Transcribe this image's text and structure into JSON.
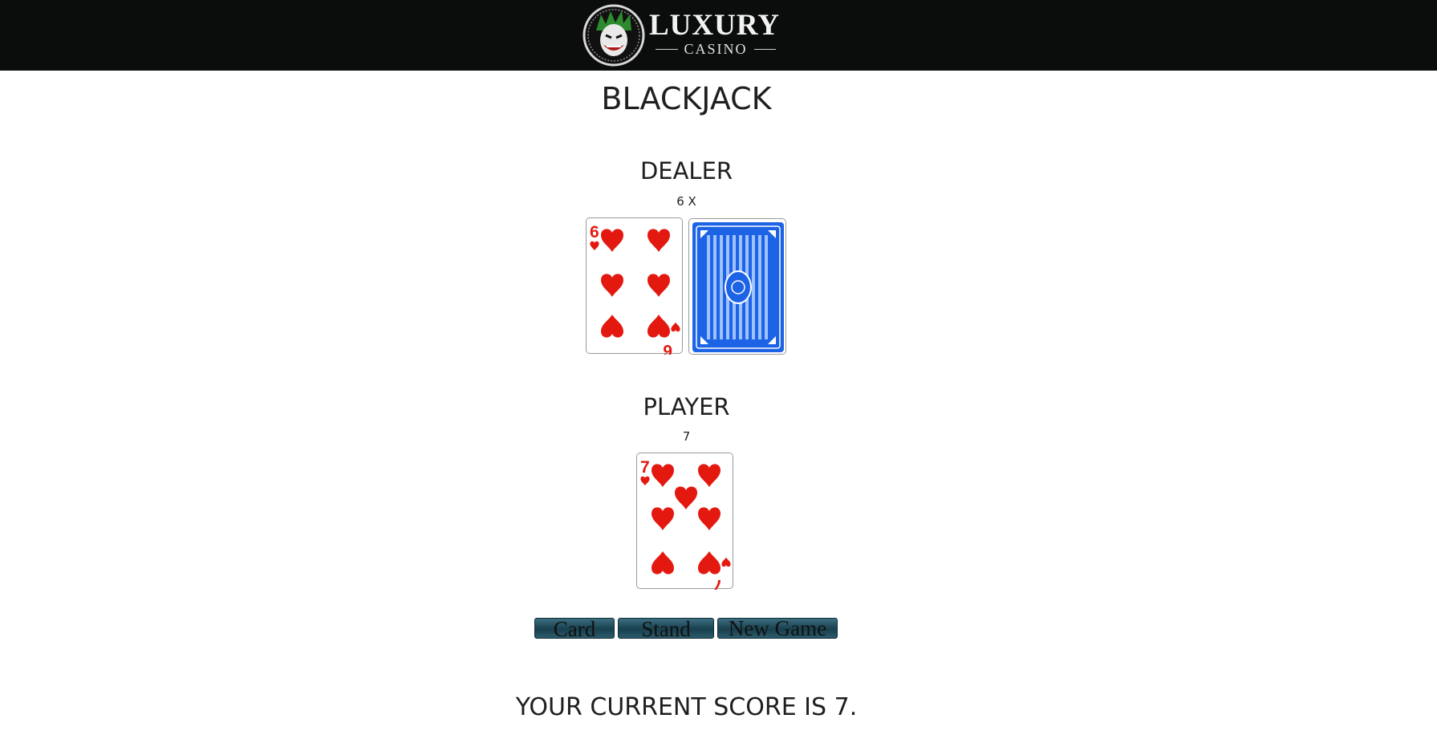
{
  "header": {
    "logo_word": "LUXURY",
    "logo_sub": "CASINO",
    "logo_icon": "joker-emblem-icon"
  },
  "game": {
    "title": "BLACKJACK",
    "dealer": {
      "heading": "DEALER",
      "value": "6 X",
      "cards": [
        {
          "rank": "6",
          "suit": "hearts",
          "face_up": true
        },
        {
          "rank": "",
          "suit": "",
          "face_up": false
        }
      ]
    },
    "player": {
      "heading": "PLAYER",
      "value": "7",
      "cards": [
        {
          "rank": "7",
          "suit": "hearts",
          "face_up": true
        }
      ]
    }
  },
  "controls": {
    "card_label": "Card",
    "stand_label": "Stand",
    "new_game_label": "New Game"
  },
  "status": {
    "score_text": "YOUR CURRENT SCORE IS 7."
  },
  "colors": {
    "header_bg": "#0b0d0c",
    "heart_red": "#e3180f",
    "card_back_blue": "#1c63e6",
    "button_teal": "#2b5c6c"
  }
}
